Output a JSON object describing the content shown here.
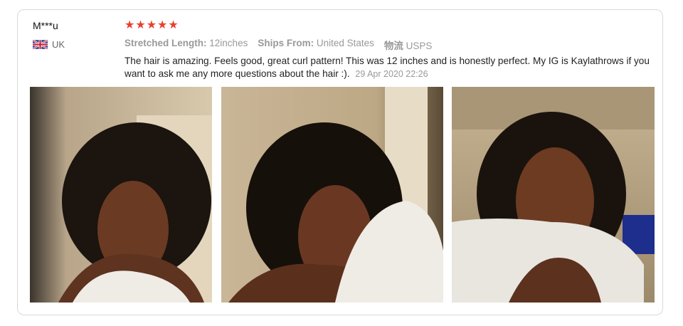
{
  "review": {
    "reviewer": "M***u",
    "country": "UK",
    "rating": 5,
    "star_glyphs": [
      "★",
      "★",
      "★",
      "★",
      "★"
    ],
    "attributes": [
      {
        "key": "Stretched Length:",
        "value": "12inches"
      },
      {
        "key": "Ships From:",
        "value": "United States"
      },
      {
        "key": "物流",
        "value": "USPS"
      }
    ],
    "text": "The hair is amazing. Feels good, great curl pattern! This was 12 inches and is honestly perfect. My IG is Kaylathrows if you want to ask me any more questions about the hair :).",
    "date": "29 Apr 2020 22:26"
  },
  "colors": {
    "star": "#e8402f",
    "border": "#d9d9d9"
  }
}
